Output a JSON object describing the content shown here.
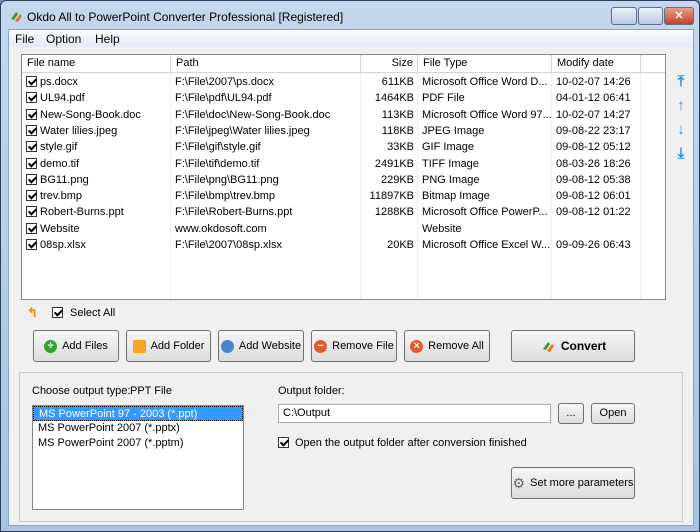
{
  "window": {
    "title": "Okdo All to PowerPoint Converter Professional [Registered]"
  },
  "menu": [
    "File",
    "Option",
    "Help"
  ],
  "table": {
    "columns": [
      "File name",
      "Path",
      "Size",
      "File Type",
      "Modify date"
    ],
    "rows": [
      [
        "ps.docx",
        "F:\\File\\2007\\ps.docx",
        "611KB",
        "Microsoft Office Word D...",
        "10-02-07 14:26"
      ],
      [
        "UL94.pdf",
        "F:\\File\\pdf\\UL94.pdf",
        "1464KB",
        "PDF File",
        "04-01-12 06:41"
      ],
      [
        "New-Song-Book.doc",
        "F:\\File\\doc\\New-Song-Book.doc",
        "113KB",
        "Microsoft Office Word 97...",
        "10-02-07 14:27"
      ],
      [
        "Water lilies.jpeg",
        "F:\\File\\jpeg\\Water lilies.jpeg",
        "118KB",
        "JPEG Image",
        "09-08-22 23:17"
      ],
      [
        "style.gif",
        "F:\\File\\gif\\style.gif",
        "33KB",
        "GIF Image",
        "09-08-12 05:12"
      ],
      [
        "demo.tif",
        "F:\\File\\tif\\demo.tif",
        "2491KB",
        "TIFF Image",
        "08-03-26 18:26"
      ],
      [
        "BG11.png",
        "F:\\File\\png\\BG11.png",
        "229KB",
        "PNG Image",
        "09-08-12 05:38"
      ],
      [
        "trev.bmp",
        "F:\\File\\bmp\\trev.bmp",
        "11897KB",
        "Bitmap Image",
        "09-08-12 06:01"
      ],
      [
        "Robert-Burns.ppt",
        "F:\\File\\Robert-Burns.ppt",
        "1288KB",
        "Microsoft Office PowerP...",
        "09-08-12 01:22"
      ],
      [
        "Website",
        "www.okdosoft.com",
        "",
        "Website",
        ""
      ],
      [
        "08sp.xlsx",
        "F:\\File\\2007\\08sp.xlsx",
        "20KB",
        "Microsoft Office Excel W...",
        "09-09-26 06:43"
      ]
    ]
  },
  "select_all": {
    "label": "Select All",
    "checked": true
  },
  "buttons": {
    "add_files": "Add Files",
    "add_folder": "Add Folder",
    "add_website": "Add Website",
    "remove_file": "Remove File",
    "remove_all": "Remove All",
    "convert": "Convert"
  },
  "output": {
    "type_label": "Choose output type:",
    "type_value": "PPT File",
    "types": [
      "MS PowerPoint 97 - 2003 (*.ppt)",
      "MS PowerPoint 2007 (*.pptx)",
      "MS PowerPoint 2007 (*.pptm)"
    ],
    "folder_label": "Output folder:",
    "folder_value": "C:\\Output",
    "browse": "...",
    "open": "Open",
    "open_after_label": "Open the output folder after conversion finished",
    "open_after_checked": true,
    "more_params": "Set more parameters"
  }
}
